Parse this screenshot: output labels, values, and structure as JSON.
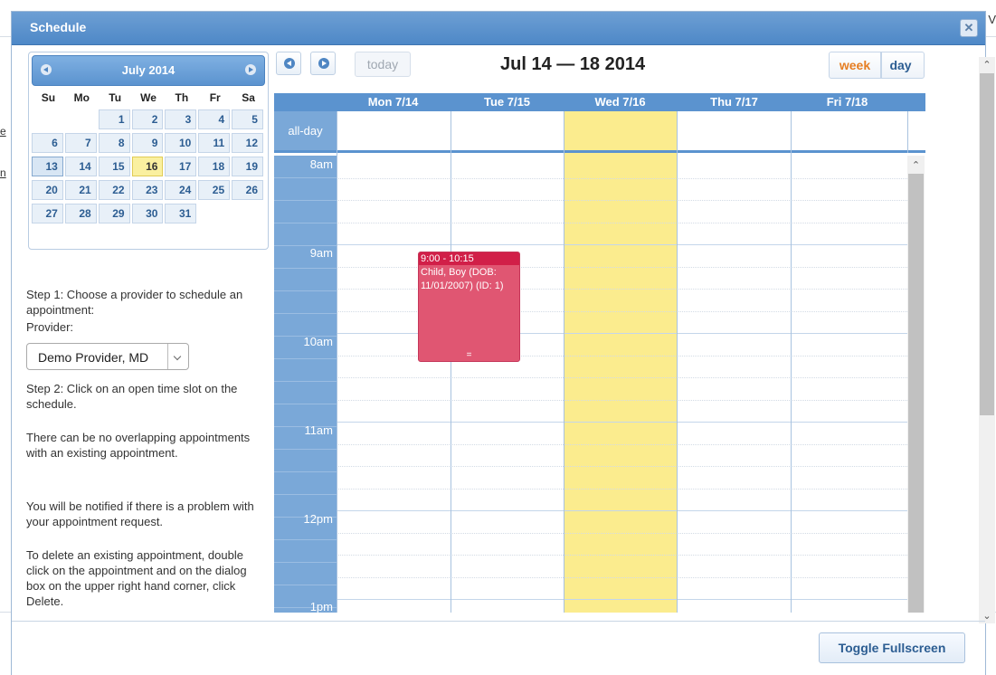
{
  "background": {
    "link1": "e",
    "link2": "n",
    "right_char": "V"
  },
  "dialog": {
    "title": "Schedule",
    "close_glyph": "✕"
  },
  "mini_calendar": {
    "title": "July 2014",
    "dow": [
      "Su",
      "Mo",
      "Tu",
      "We",
      "Th",
      "Fr",
      "Sa"
    ],
    "weeks": [
      [
        "",
        "",
        "1",
        "2",
        "3",
        "4",
        "5"
      ],
      [
        "6",
        "7",
        "8",
        "9",
        "10",
        "11",
        "12"
      ],
      [
        "13",
        "14",
        "15",
        "16",
        "17",
        "18",
        "19"
      ],
      [
        "20",
        "21",
        "22",
        "23",
        "24",
        "25",
        "26"
      ],
      [
        "27",
        "28",
        "29",
        "30",
        "31",
        "",
        ""
      ]
    ],
    "today": "16",
    "selected": "13"
  },
  "instructions": {
    "step1": "Step 1: Choose a provider to schedule an appointment:",
    "provider_label": "Provider:",
    "provider_value": "Demo Provider, MD",
    "step2": "Step 2: Click on an open time slot on the schedule.",
    "note1": "There can be no overlapping appointments with an existing appointment.",
    "note2": "You will be notified if there is a problem with your appointment request.",
    "note3": "To delete an existing appointment, double click on the appointment and on the dialog box on the upper right hand corner, click Delete."
  },
  "toolbar": {
    "today_label": "today",
    "range_title": "Jul 14 — 18 2014",
    "week_label": "week",
    "day_label": "day"
  },
  "week": {
    "columns": [
      "Mon 7/14",
      "Tue 7/15",
      "Wed 7/16",
      "Thu 7/17",
      "Fri 7/18"
    ],
    "allday_label": "all-day",
    "time_labels": [
      "8am",
      "9am",
      "10am",
      "11am",
      "12pm",
      "1pm"
    ]
  },
  "event": {
    "time": "9:00 - 10:15",
    "title": "Child, Boy (DOB: 11/01/2007) (ID: 1)",
    "color": "#e05672",
    "grip": "="
  },
  "footer": {
    "toggle_label": "Toggle Fullscreen"
  }
}
